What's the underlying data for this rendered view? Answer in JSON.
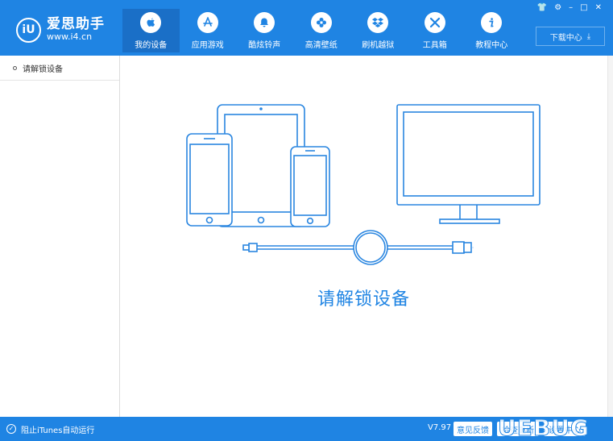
{
  "app": {
    "name": "爱思助手",
    "url": "www.i4.cn",
    "logo_mark": "iU",
    "accent_color": "#1f84e3"
  },
  "nav": {
    "items": [
      {
        "label": "我的设备",
        "icon": "apple-icon",
        "active": true
      },
      {
        "label": "应用游戏",
        "icon": "app-store-icon",
        "active": false
      },
      {
        "label": "酷炫铃声",
        "icon": "bell-icon",
        "active": false
      },
      {
        "label": "高清壁纸",
        "icon": "flower-icon",
        "active": false
      },
      {
        "label": "刷机越狱",
        "icon": "dropbox-icon",
        "active": false
      },
      {
        "label": "工具箱",
        "icon": "tools-icon",
        "active": false
      },
      {
        "label": "教程中心",
        "icon": "info-icon",
        "active": false
      }
    ]
  },
  "window_controls": {
    "shirt": "👕",
    "settings": "⚙",
    "minimize": "–",
    "maximize": "□",
    "close": "✕"
  },
  "download_center": {
    "label": "下载中心",
    "icon": "download-icon",
    "glyph": "⤓"
  },
  "sidebar": {
    "items": [
      {
        "label": "请解锁设备"
      }
    ]
  },
  "main": {
    "message": "请解锁设备"
  },
  "status": {
    "itunes_label": "阻止iTunes自动运行",
    "check_glyph": "✓",
    "version": "V7.97",
    "feedback_label": "意见反馈",
    "button2_label": "检查更新",
    "button3_label": "设置中心",
    "watermark": "UEBUG"
  }
}
